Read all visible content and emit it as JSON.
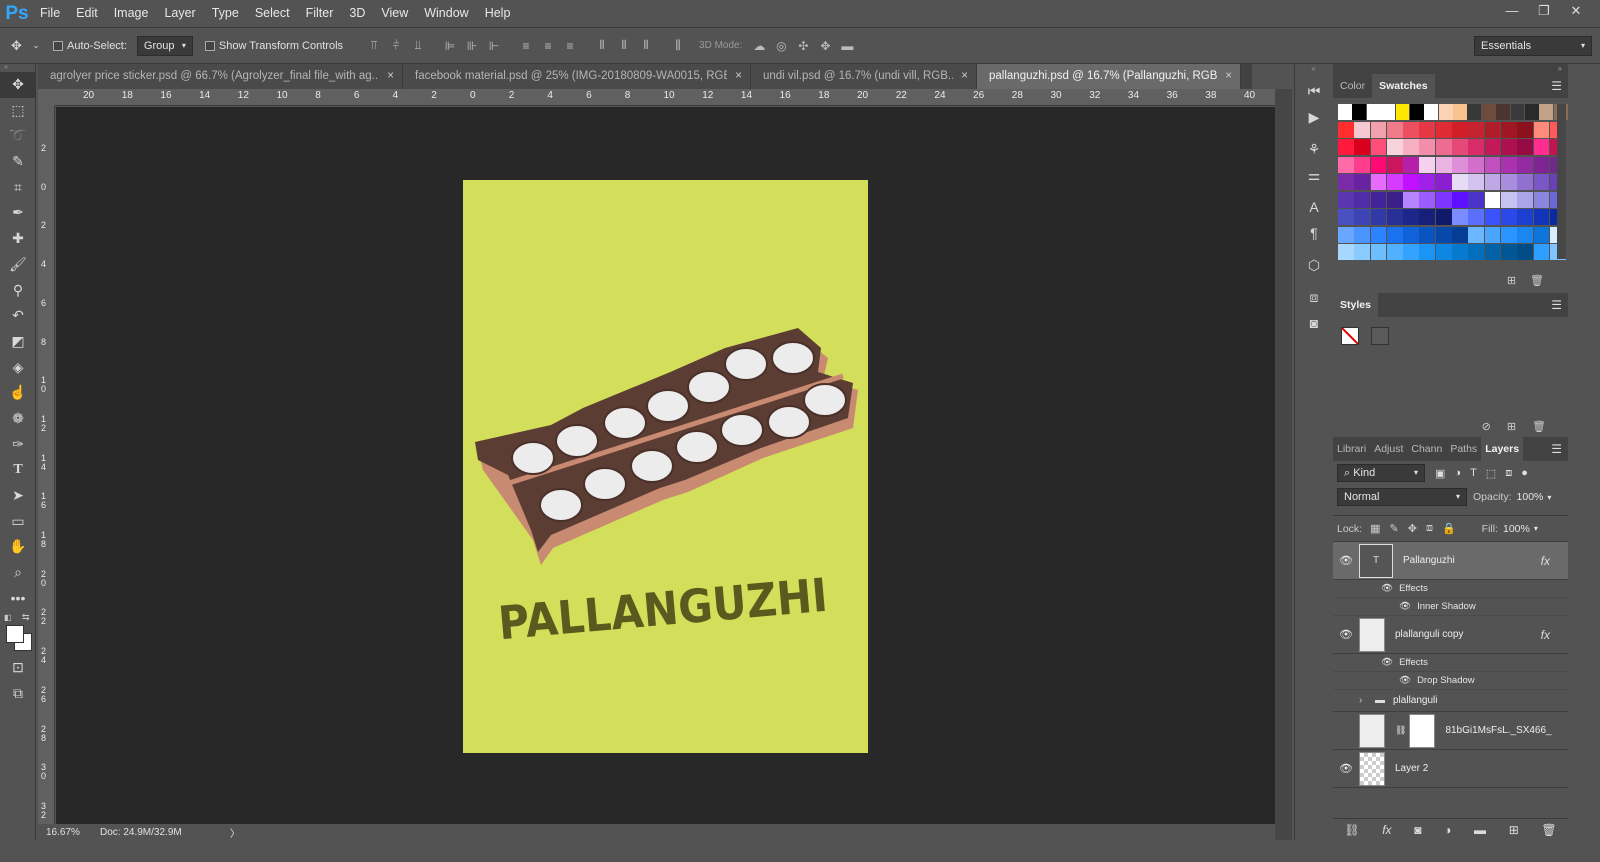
{
  "app": {
    "logo": "Ps"
  },
  "menu": [
    "File",
    "Edit",
    "Image",
    "Layer",
    "Type",
    "Select",
    "Filter",
    "3D",
    "View",
    "Window",
    "Help"
  ],
  "window_controls": {
    "minimize": "—",
    "restore": "❐",
    "close": "✕"
  },
  "options": {
    "auto_select_label": "Auto-Select:",
    "auto_select_checked": false,
    "auto_select_value": "Group",
    "show_transform_label": "Show Transform Controls",
    "show_transform_checked": false,
    "mode_3d_label": "3D Mode:",
    "workspace": "Essentials"
  },
  "tabs": [
    {
      "label": "agrolyer price sticker.psd @ 66.7% (Agrolyzer_final file_with ag...",
      "active": false
    },
    {
      "label": "facebook material.psd @ 25% (IMG-20180809-WA0015, RGB...",
      "active": false
    },
    {
      "label": "undi vil.psd @ 16.7% (undi vill, RGB...",
      "active": false
    },
    {
      "label": "pallanguzhi.psd @ 16.7% (Pallanguzhi, RGB/8)",
      "active": true
    }
  ],
  "tab_close": "×",
  "ruler_top": [
    "20",
    "18",
    "16",
    "14",
    "12",
    "10",
    "8",
    "6",
    "4",
    "2",
    "0",
    "2",
    "4",
    "6",
    "8",
    "10",
    "12",
    "14",
    "16",
    "18",
    "20",
    "22",
    "24",
    "26",
    "28",
    "30",
    "32",
    "34",
    "36",
    "38",
    "40"
  ],
  "ruler_left": [
    "2",
    "0",
    "2",
    "4",
    "6",
    "8",
    "1 0",
    "1 2",
    "1 4",
    "1 6",
    "1 8",
    "2 0",
    "2 2",
    "2 4",
    "2 6",
    "2 8",
    "3 0",
    "3 2"
  ],
  "artwork": {
    "title_text": "PALLANGUZHI",
    "bg_color": "#d3de5a",
    "board_color": "#5c3d33",
    "board_edge_color": "#c98a72",
    "text_color": "#5a5a1e"
  },
  "status": {
    "zoom": "16.67%",
    "doc": "Doc: 24.9M/32.9M",
    "arrow": "〉"
  },
  "color_panel": {
    "tabs": [
      {
        "label": "Color",
        "active": false
      },
      {
        "label": "Swatches",
        "active": true
      }
    ],
    "swatch_rows": [
      [
        "#ffffff",
        "#000000",
        "#ffffff",
        "#ffffff",
        "#ffe600",
        "#000000",
        "#ffffff",
        "#fbd2b4",
        "#f6c38c",
        "#383838",
        "#6f4a3e",
        "#4a3530",
        "#3a3a3a",
        "#2a2a2a",
        "#c2a189",
        "#8c6b58"
      ],
      [
        "#ff2e2e",
        "#f6c9d0",
        "#f2a1ac",
        "#ee7a8a",
        "#ec4f5f",
        "#e63745",
        "#e02a34",
        "#d11f2a",
        "#c4232f",
        "#b01d29",
        "#9f1723",
        "#8c111c",
        "#ff8a7a",
        "#ff5a5a"
      ],
      [
        "#ff1a3d",
        "#d8001c",
        "#ff4d7a",
        "#f9d3dc",
        "#f6b0c2",
        "#f28eaa",
        "#ee6b92",
        "#e44979",
        "#d72c67",
        "#c31959",
        "#ad104e",
        "#970b44",
        "#ff2d90",
        "#c2144f"
      ],
      [
        "#ff6aa8",
        "#ff3d8e",
        "#ff0a75",
        "#cb155e",
        "#b61faa",
        "#f5d0ef",
        "#ebb3e3",
        "#df8fd8",
        "#d46ecc",
        "#c24fc0",
        "#aa32b0",
        "#942aa1",
        "#7f2495",
        "#6d2a8a"
      ],
      [
        "#7a2ca8",
        "#6a23a0",
        "#e86bff",
        "#d63cff",
        "#c10fff",
        "#9f20e8",
        "#8b1fcf",
        "#e6dcf5",
        "#d4c3ee",
        "#bfa8e6",
        "#a88cdd",
        "#9170d2",
        "#7a56c6",
        "#6641b8"
      ],
      [
        "#5a37b0",
        "#4f2da8",
        "#432399",
        "#3b1d8c",
        "#b784ff",
        "#9b5cff",
        "#7e35ff",
        "#5f0fff",
        "#4a33c9",
        "#ffffff",
        "#c6c3f2",
        "#a8a5ea",
        "#8a86e0",
        "#6b67d6"
      ],
      [
        "#4a4fc2",
        "#3d44b4",
        "#3139a6",
        "#283098",
        "#1d2689",
        "#16207b",
        "#101a6b",
        "#7a8cff",
        "#5b6fff",
        "#3b52ff",
        "#2a49e8",
        "#1c3fd0",
        "#1234b8",
        "#0a2aa0"
      ],
      [
        "#6aa6ff",
        "#4a94ff",
        "#2c83ff",
        "#1a72ee",
        "#0f62d9",
        "#0a54c2",
        "#0648ab",
        "#043d95",
        "#6ab6ff",
        "#4aa5ff",
        "#2c94ff",
        "#1a86f0",
        "#0d76dc",
        "#d8ecff"
      ],
      [
        "#a6d8ff",
        "#8acbff",
        "#6cbeff",
        "#4fb1ff",
        "#33a3ff",
        "#1a95f5",
        "#0d87e3",
        "#077acf",
        "#036ebb",
        "#0162a8",
        "#015796",
        "#004c84",
        "#2e9eff",
        "#80c4ff"
      ]
    ]
  },
  "styles_panel": {
    "tab": "Styles"
  },
  "layers_panel": {
    "tabs": [
      {
        "label": "Librari",
        "active": false
      },
      {
        "label": "Adjust",
        "active": false
      },
      {
        "label": "Chann",
        "active": false
      },
      {
        "label": "Paths",
        "active": false
      },
      {
        "label": "Layers",
        "active": true
      }
    ],
    "kind_label": "Kind",
    "blend_mode": "Normal",
    "opacity_label": "Opacity:",
    "opacity_value": "100%",
    "lock_label": "Lock:",
    "fill_label": "Fill:",
    "fill_value": "100%",
    "fx_label": "fx",
    "layers": [
      {
        "name": "Pallanguzhi",
        "visible": true,
        "selected": true,
        "fx": true,
        "type": "text",
        "effects_label": "Effects",
        "effects": [
          "Inner Shadow"
        ]
      },
      {
        "name": "plallanguli copy",
        "visible": true,
        "selected": false,
        "fx": true,
        "type": "image",
        "effects_label": "Effects",
        "effects": [
          "Drop Shadow"
        ]
      },
      {
        "name": "plallanguli",
        "visible": false,
        "selected": false,
        "fx": false,
        "type": "group"
      },
      {
        "name": "81bGi1MsFsL._SX466_",
        "visible": false,
        "selected": false,
        "fx": false,
        "type": "masked"
      },
      {
        "name": "Layer 2",
        "visible": true,
        "selected": false,
        "fx": false,
        "type": "transparent"
      }
    ]
  }
}
